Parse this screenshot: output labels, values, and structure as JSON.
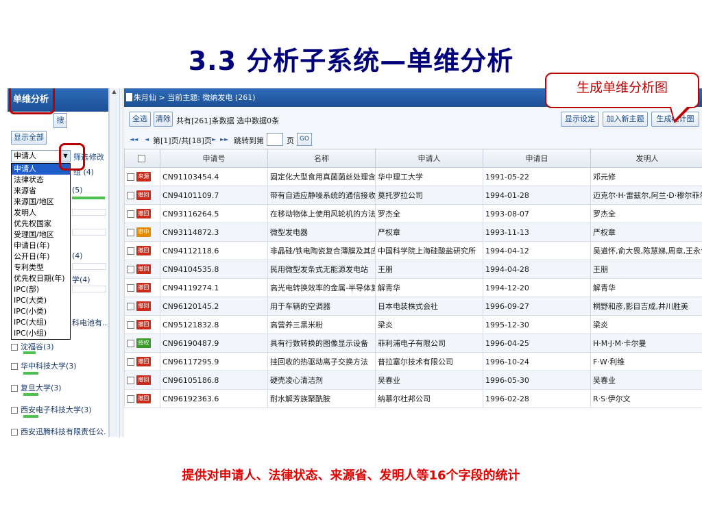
{
  "slide": {
    "title": "3.3 分析子系统—单维分析",
    "callout": "生成单维分析图",
    "footer": "提供对申请人、法律状态、来源省、发明人等16个字段的统计"
  },
  "left_panel": {
    "header": "单维分析",
    "search_button": "搜",
    "show_all_button": "显示全部",
    "select_value": "申请人",
    "filter_link": "筛选",
    "modify_link": "修改",
    "dropdown_options": [
      "申请人",
      "法律状态",
      "来源省",
      "来源国/地区",
      "发明人",
      "优先权国家",
      "受理国/地区",
      "申请日(年)",
      "公开日(年)",
      "专利类型",
      "优先权日期(年)",
      "IPC(部)",
      "IPC(大类)",
      "IPC(小类)",
      "IPC(大组)",
      "IPC(小组)"
    ],
    "peek_texts": [
      "组 (4)",
      "(5)",
      "(4)",
      "学(4)",
      "科电池有…"
    ],
    "items": [
      {
        "label": "沈福谷(3)",
        "bar": 0.15
      },
      {
        "label": "华中科技大学(3)",
        "bar": 0.18
      },
      {
        "label": "复旦大学(3)",
        "bar": 0.18
      },
      {
        "label": "西安电子科技大学(3)",
        "bar": 0.18
      },
      {
        "label": "西安迅腾科技有限责任公…",
        "bar": 0.18
      }
    ],
    "first_bar_level": 0.95
  },
  "main": {
    "breadcrumb": "朱月仙 > 当前主题: 微纳发电 (261)",
    "toolbar": {
      "select_all": "全选",
      "clear": "清除",
      "info": "共有[261]条数据  选中数据0条",
      "display_settings": "显示设定",
      "add_topic": "加入新主题",
      "generate_chart": "生成统计图"
    },
    "pager": {
      "first": "◄◄",
      "prev": "◄",
      "page_text": "第[1]页/共[18]页",
      "next": "►",
      "last": "►►",
      "jump_label": "跳转到第",
      "page_unit": "页",
      "go": "GO"
    },
    "columns": [
      "申请号",
      "名称",
      "申请人",
      "申请日",
      "发明人"
    ],
    "status_colors": {
      "来源": "#cc2a1a",
      "撤回": "#cc2a1a",
      "审中": "#e68a00",
      "授权": "#3a9a2a"
    },
    "rows": [
      {
        "status": "来源",
        "id": "CN91103454.4",
        "name": "固定化大型食用真菌菌丝处理含酚废水",
        "applicant": "华中理工大学",
        "date": "1991-05-22",
        "inventor": "邓元修"
      },
      {
        "status": "撤回",
        "id": "CN94101109.7",
        "name": "带有自适应静噪系统的通信接收机",
        "applicant": "莫托罗拉公司",
        "date": "1994-01-28",
        "inventor": "迈克尔·H·雷兹尔,阿兰·D·穆尔菲尔德"
      },
      {
        "status": "撤回",
        "id": "CN93116264.5",
        "name": "在移动物体上使用风轮机的方法",
        "applicant": "罗杰全",
        "date": "1993-08-07",
        "inventor": "罗杰全"
      },
      {
        "status": "审中",
        "id": "CN93114872.3",
        "name": "微型发电器",
        "applicant": "严权章",
        "date": "1993-11-13",
        "inventor": "严权章"
      },
      {
        "status": "撤回",
        "id": "CN94112118.6",
        "name": "非晶硅/铁电陶瓷复合薄膜及其应用",
        "applicant": "中国科学院上海硅酸盐研究所",
        "date": "1994-04-12",
        "inventor": "吴道怀,俞大畏,陈慧娣,周章,王永令"
      },
      {
        "status": "撤回",
        "id": "CN94104535.8",
        "name": "民用微型发条式无能源发电站",
        "applicant": "王朋",
        "date": "1994-04-28",
        "inventor": "王朋"
      },
      {
        "status": "撤回",
        "id": "CN94119274.1",
        "name": "高光电转换效率的金属-半导体复合膜",
        "applicant": "解青华",
        "date": "1994-12-20",
        "inventor": "解青华"
      },
      {
        "status": "撤回",
        "id": "CN96120145.2",
        "name": "用于车辆的空调器",
        "applicant": "日本电装株式会社",
        "date": "1996-09-27",
        "inventor": "桐野和彦,影目吉成,井川胜美"
      },
      {
        "status": "撤回",
        "id": "CN95121832.8",
        "name": "高营养三黑米粉",
        "applicant": "梁炎",
        "date": "1995-12-30",
        "inventor": "梁炎"
      },
      {
        "status": "授权",
        "id": "CN96190487.9",
        "name": "具有行数转换的图像显示设备",
        "applicant": "菲利浦电子有限公司",
        "date": "1996-04-25",
        "inventor": "H·M·J·M·卡尔曼"
      },
      {
        "status": "撤回",
        "id": "CN96117295.9",
        "name": "挂回收的热驱动离子交换方法",
        "applicant": "普拉塞尔技术有限公司",
        "date": "1996-10-24",
        "inventor": "F·W·利维"
      },
      {
        "status": "撤回",
        "id": "CN96105186.8",
        "name": "硬壳凌心清洁剂",
        "applicant": "吴春业",
        "date": "1996-05-30",
        "inventor": "吴春业"
      },
      {
        "status": "撤回",
        "id": "CN96192363.6",
        "name": "耐水解芳族聚酰胺",
        "applicant": "纳慕尔杜邦公司",
        "date": "1996-02-28",
        "inventor": "R·S·伊尔文"
      }
    ]
  }
}
